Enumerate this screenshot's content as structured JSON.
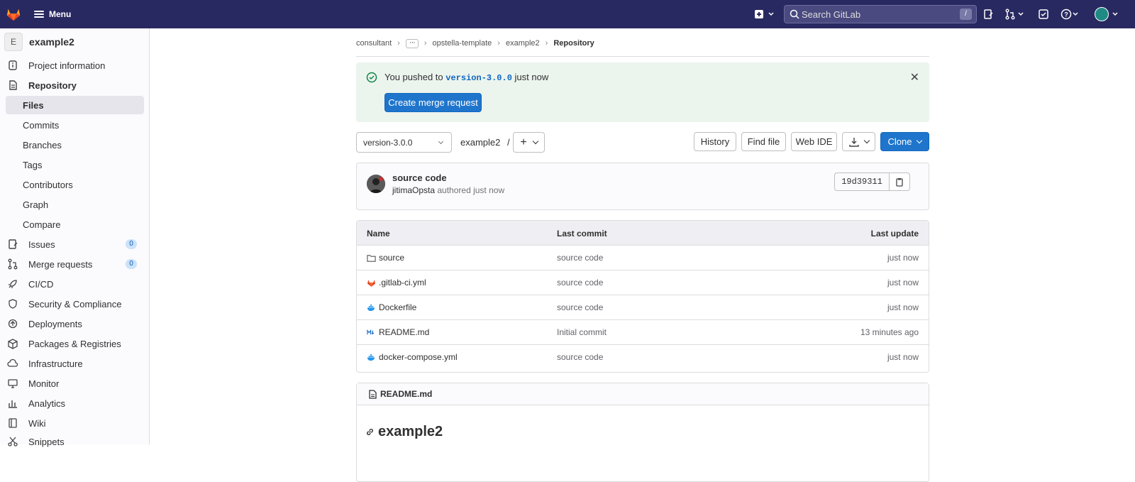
{
  "topbar": {
    "menu_label": "Menu",
    "search_placeholder": "Search GitLab",
    "search_shortcut": "/"
  },
  "sidebar": {
    "project_initial": "E",
    "project_name": "example2",
    "items": [
      {
        "label": "Project information",
        "icon": "info-icon"
      },
      {
        "label": "Repository",
        "icon": "repository-icon"
      },
      {
        "label": "Files",
        "icon": ""
      },
      {
        "label": "Commits",
        "icon": ""
      },
      {
        "label": "Branches",
        "icon": ""
      },
      {
        "label": "Tags",
        "icon": ""
      },
      {
        "label": "Contributors",
        "icon": ""
      },
      {
        "label": "Graph",
        "icon": ""
      },
      {
        "label": "Compare",
        "icon": ""
      },
      {
        "label": "Issues",
        "icon": "issues-icon",
        "badge": "0"
      },
      {
        "label": "Merge requests",
        "icon": "merge-request-icon",
        "badge": "0"
      },
      {
        "label": "CI/CD",
        "icon": "rocket-icon"
      },
      {
        "label": "Security & Compliance",
        "icon": "shield-icon"
      },
      {
        "label": "Deployments",
        "icon": "deployments-icon"
      },
      {
        "label": "Packages & Registries",
        "icon": "package-icon"
      },
      {
        "label": "Infrastructure",
        "icon": "cloud-icon"
      },
      {
        "label": "Monitor",
        "icon": "monitor-icon"
      },
      {
        "label": "Analytics",
        "icon": "chart-icon"
      },
      {
        "label": "Wiki",
        "icon": "book-icon"
      },
      {
        "label": "Snippets",
        "icon": "snippet-icon"
      }
    ]
  },
  "breadcrumb": {
    "items": [
      "consultant",
      "opstella-template",
      "example2"
    ],
    "current": "Repository"
  },
  "alert": {
    "prefix": "You pushed to",
    "branch": "version-3.0.0",
    "suffix": "just now",
    "button": "Create merge request"
  },
  "toolbar": {
    "branch": "version-3.0.0",
    "path": "example2",
    "path_sep": "/",
    "add_label": "+",
    "history": "History",
    "find_file": "Find file",
    "web_ide": "Web IDE",
    "clone": "Clone"
  },
  "commit": {
    "title": "source code",
    "author": "jitimaOpsta",
    "when": "authored just now",
    "sha": "19d39311"
  },
  "files": {
    "headers": [
      "Name",
      "Last commit",
      "Last update"
    ],
    "rows": [
      {
        "name": "source",
        "icon": "folder-icon",
        "commit": "source code",
        "updated": "just now"
      },
      {
        "name": ".gitlab-ci.yml",
        "icon": "gitlab-icon",
        "commit": "source code",
        "updated": "just now"
      },
      {
        "name": "Dockerfile",
        "icon": "docker-icon",
        "commit": "source code",
        "updated": "just now"
      },
      {
        "name": "README.md",
        "icon": "markdown-icon",
        "commit": "Initial commit",
        "updated": "13 minutes ago"
      },
      {
        "name": "docker-compose.yml",
        "icon": "docker-icon",
        "commit": "source code",
        "updated": "just now"
      }
    ]
  },
  "readme": {
    "filename": "README.md",
    "heading": "example2"
  }
}
